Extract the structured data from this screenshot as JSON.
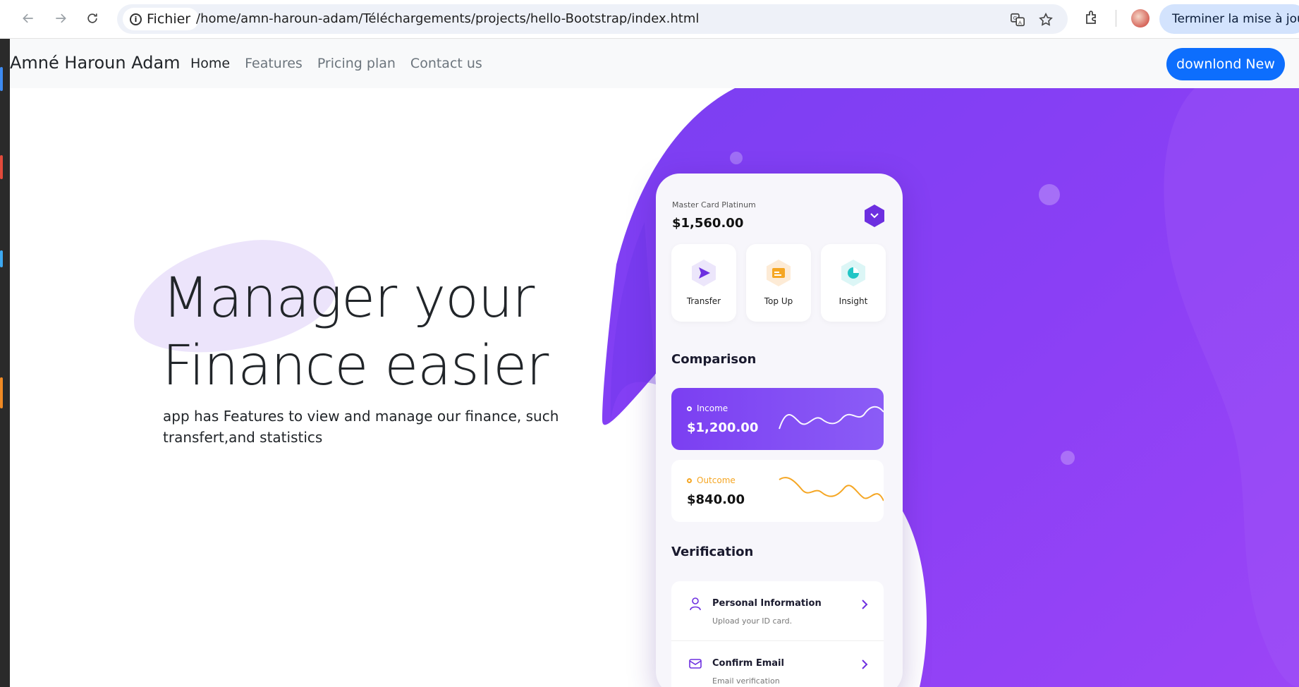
{
  "browser": {
    "site_chip": "Fichier",
    "url": "/home/amn-haroun-adam/Téléchargements/projects/hello-Bootstrap/index.html",
    "update_label": "Terminer la mise à jour"
  },
  "navbar": {
    "brand": "Amné Haroun Adam",
    "links": [
      "Home",
      "Features",
      "Pricing plan",
      "Contact us"
    ],
    "cta": "downlond New"
  },
  "hero": {
    "headline_line1": "Manager your",
    "headline_line2": "Finance easier",
    "subtitle": "app has Features to view and manage our finance, such transfert,and statistics"
  },
  "phone": {
    "card_label": "Master Card Platinum",
    "card_balance": "$1,560.00",
    "actions": [
      {
        "label": "Transfer",
        "icon": "send-icon"
      },
      {
        "label": "Top Up",
        "icon": "card-icon"
      },
      {
        "label": "Insight",
        "icon": "pie-chart-icon"
      }
    ],
    "comparison_title": "Comparison",
    "income": {
      "label": "Income",
      "value": "$1,200.00"
    },
    "outcome": {
      "label": "Outcome",
      "value": "$840.00"
    },
    "verification_title": "Verification",
    "verification_items": [
      {
        "title": "Personal Information",
        "subtitle": "Upload your ID card.",
        "icon": "user-icon"
      },
      {
        "title": "Confirm Email",
        "subtitle": "Email verification",
        "icon": "mail-icon"
      }
    ]
  },
  "colors": {
    "primary": "#0d6efd",
    "purple": "#7b3ff2",
    "outcome_line": "#f5a623"
  }
}
